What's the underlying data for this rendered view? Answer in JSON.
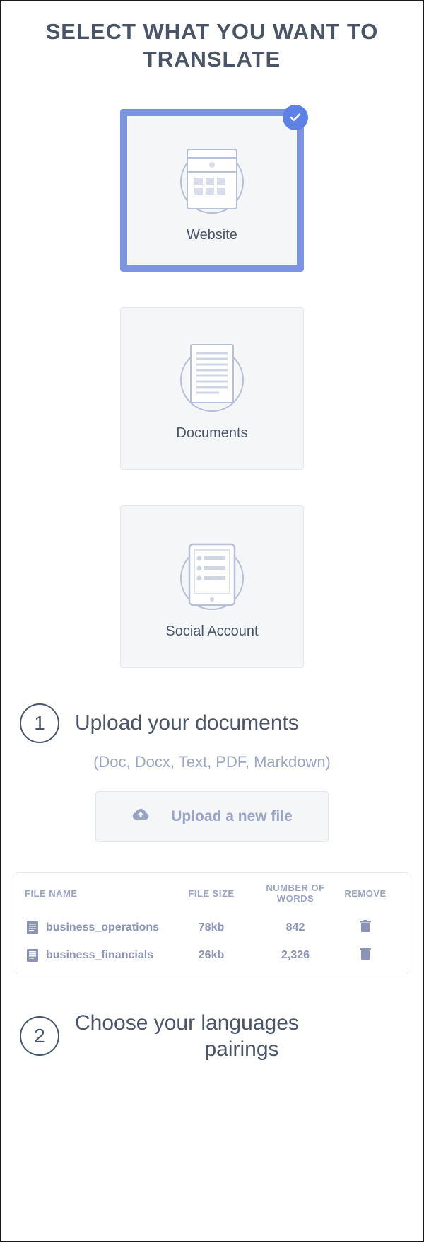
{
  "title": "SELECT WHAT YOU WANT TO TRANSLATE",
  "options": {
    "website": {
      "label": "Website",
      "selected": true
    },
    "documents": {
      "label": "Documents",
      "selected": false
    },
    "social": {
      "label": "Social Account",
      "selected": false
    }
  },
  "step1": {
    "number": "1",
    "title": "Upload your documents",
    "subtitle": "(Doc, Docx, Text, PDF, Markdown)",
    "upload_label": "Upload a new file"
  },
  "table": {
    "headers": {
      "file_name": "FILE NAME",
      "file_size": "FILE SIZE",
      "words": "NUMBER OF WORDS",
      "remove": "REMOVE"
    },
    "rows": [
      {
        "name": "business_operations",
        "size": "78kb",
        "words": "842"
      },
      {
        "name": "business_financials",
        "size": "26kb",
        "words": "2,326"
      }
    ]
  },
  "step2": {
    "number": "2",
    "title_line1": "Choose your languages",
    "title_line2": "pairings"
  }
}
